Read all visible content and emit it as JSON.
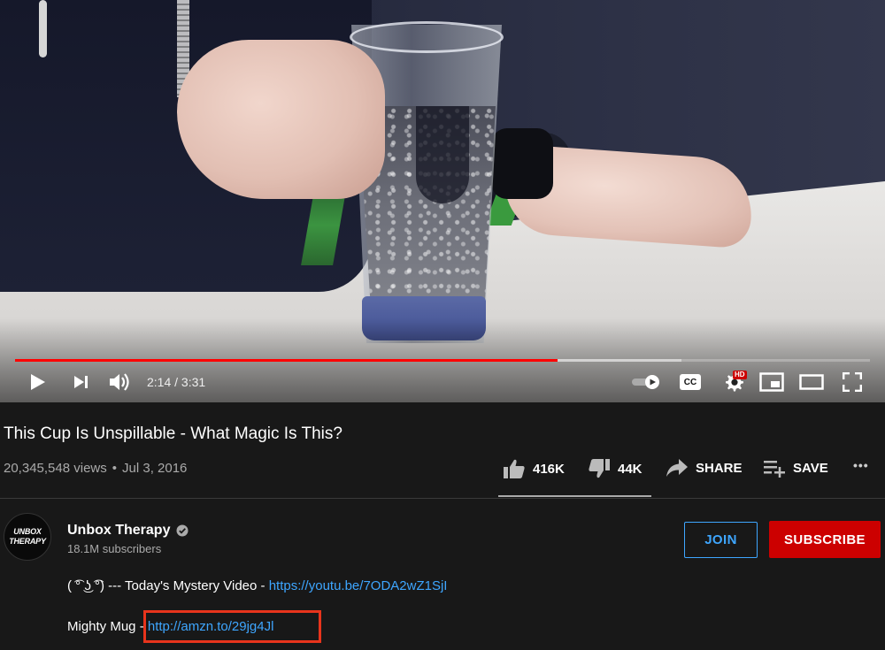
{
  "player": {
    "time_display": "2:14 / 3:31",
    "progress": {
      "played_fraction": 0.635,
      "buffered_fraction": 0.78
    },
    "icons": [
      "play-icon",
      "next-icon",
      "volume-icon",
      "autoplay-toggle-icon",
      "captions-icon",
      "settings-icon",
      "miniplayer-icon",
      "theater-icon",
      "fullscreen-icon"
    ],
    "captions_label": "CC",
    "hd_badge": "HD"
  },
  "video": {
    "title": "This Cup Is Unspillable - What Magic Is This?",
    "views": "20,345,548 views",
    "separator": "•",
    "date": "Jul 3, 2016",
    "likes": "416K",
    "dislikes": "44K",
    "share_label": "SHARE",
    "save_label": "SAVE",
    "more_label": "•••"
  },
  "channel": {
    "avatar_text_line1": "UNBOX",
    "avatar_text_line2": "THERAPY",
    "name": "Unbox Therapy",
    "subscribers": "18.1M subscribers",
    "join_label": "JOIN",
    "subscribe_label": "SUBSCRIBE"
  },
  "description": {
    "line1_prefix": "( ͡° ͜ʖ ͡°) --- Today's Mystery Video - ",
    "line1_link": "https://youtu.be/7ODA2wZ1SjI",
    "line2_prefix": "Mighty Mug - ",
    "line2_link": "http://amzn.to/29jg4Jl"
  },
  "colors": {
    "background": "#181818",
    "progress_red": "#ff0000",
    "link_blue": "#3ea6ff",
    "subscribe_red": "#cc0000",
    "highlight_box": "#e8341c"
  }
}
